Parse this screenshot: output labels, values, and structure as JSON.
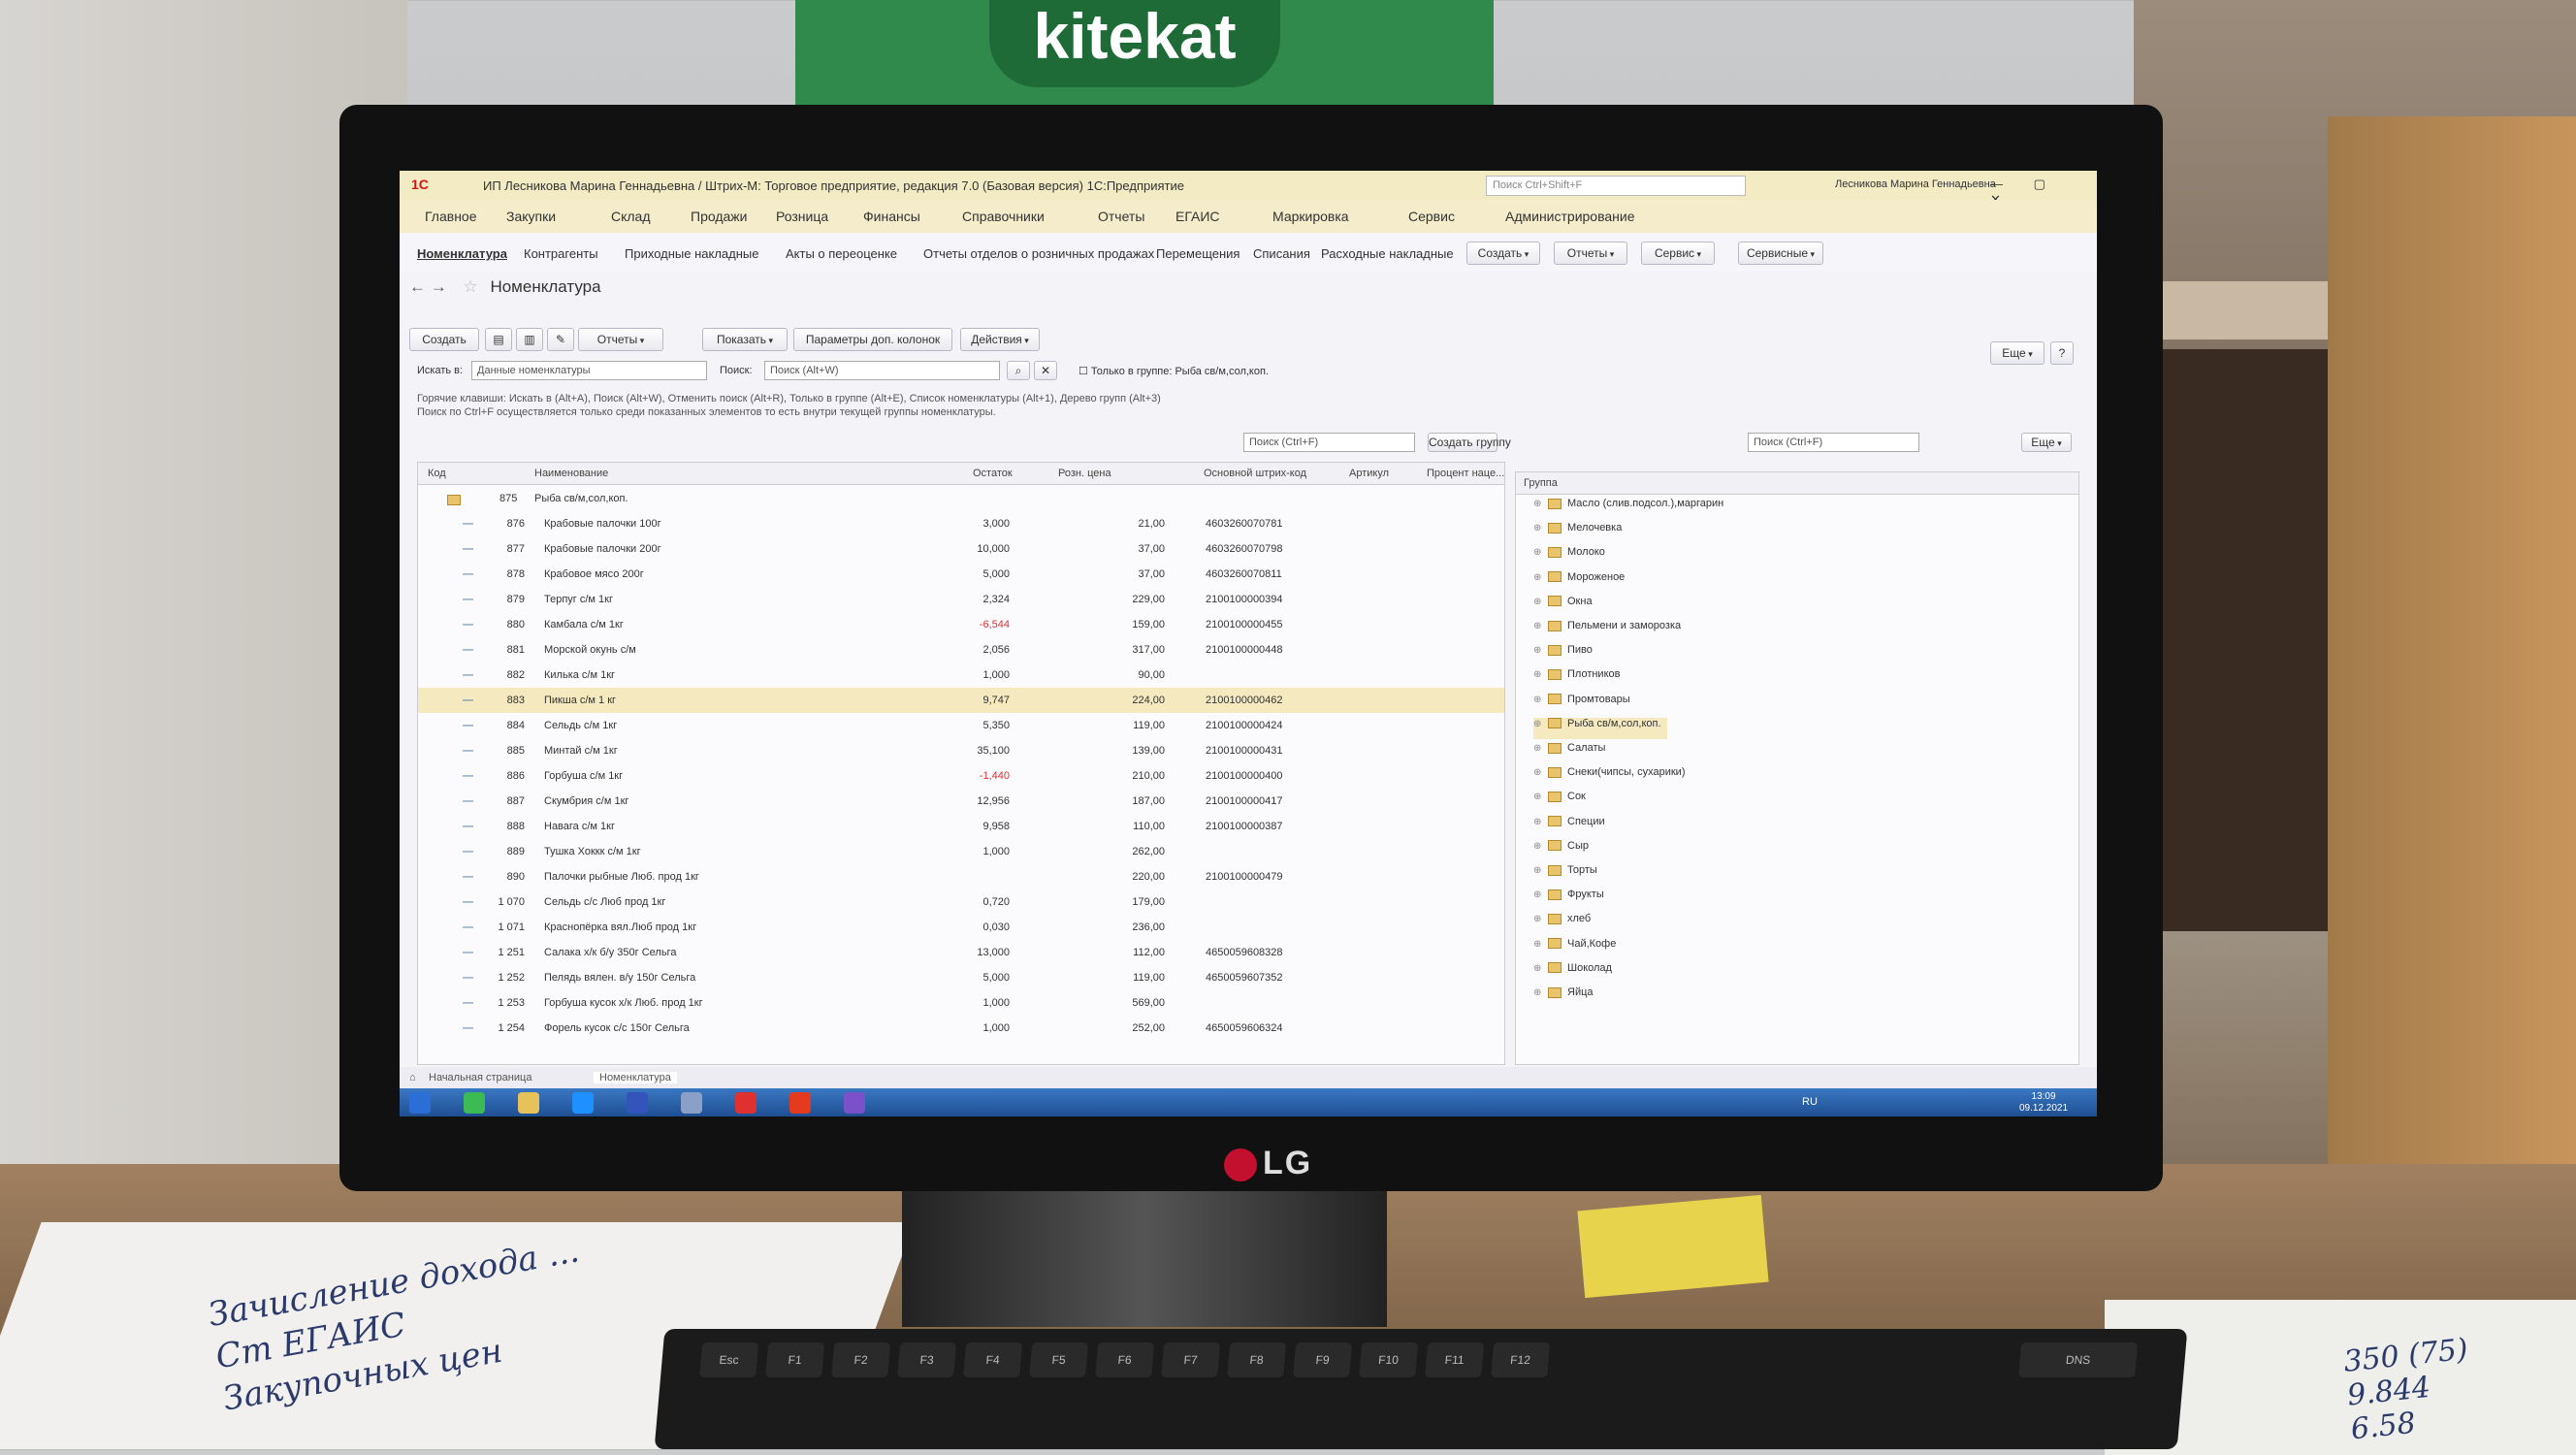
{
  "scene": {
    "brand": "kitekat",
    "monitor_brand": "LG",
    "keyboard_brand": "DNS",
    "note_left": "Зачисление дохода ...\nСт ЕГАИС\nЗакупочных цен",
    "note_right": "350 (75)\n9.844\n6.58",
    "keys": [
      "Esc",
      "F1",
      "F2",
      "F3",
      "F4",
      "F5",
      "F6",
      "F7",
      "F8",
      "F9",
      "F10",
      "F11",
      "F12"
    ]
  },
  "window": {
    "app_logo": "1С",
    "title": "ИП Лесникова Марина Геннадьевна / Штрих-М: Торговое предприятие, редакция 7.0 (Базовая версия) 1С:Предприятие",
    "search_placeholder": "Поиск Ctrl+Shift+F",
    "user": "Лесникова Марина Геннадьевна",
    "controls": "— ▢ ✕"
  },
  "menu": [
    "Главное",
    "Закупки",
    "Склад",
    "Продажи",
    "Розница",
    "Финансы",
    "Справочники",
    "Отчеты",
    "ЕГАИС",
    "Маркировка",
    "Сервис",
    "Администрирование"
  ],
  "submenu": [
    "Номенклатура",
    "Контрагенты",
    "Приходные накладные",
    "Акты о переоценке",
    "Отчеты отделов о розничных продажах",
    "Перемещения",
    "Списания",
    "Расходные накладные"
  ],
  "submenu_buttons": [
    "Создать",
    "Отчеты",
    "Сервис",
    "Сервисные"
  ],
  "form": {
    "title": "Номенклатура",
    "buttons": {
      "create": "Создать",
      "reports": "Отчеты",
      "show": "Показать",
      "params": "Параметры доп. колонок",
      "actions": "Действия",
      "more": "Еще",
      "help": "?"
    },
    "search_in_label": "Искать в:",
    "search_in_value": "Данные номенклатуры",
    "search_label": "Поиск:",
    "search_placeholder": "Поиск (Alt+W)",
    "group_only": "Только в группе: Рыба св/м,сол,коп.",
    "hint1": "Горячие клавиши: Искать в (Alt+A), Поиск (Alt+W), Отменить поиск (Alt+R), Только в группе (Alt+E), Список номенклатуры (Alt+1), Дерево групп (Alt+3)",
    "hint2": "Поиск по Ctrl+F осуществляется только среди показанных элементов то есть внутри текущей группы номенклатуры.",
    "list_search_placeholder": "Поиск (Ctrl+F)",
    "create_group": "Создать группу",
    "tree_search_placeholder": "Поиск (Ctrl+F)",
    "tree_more": "Еще"
  },
  "table": {
    "headers": [
      "Код",
      "Наименование",
      "Остаток",
      "Розн. цена",
      "Основной штрих-код",
      "Артикул",
      "Процент наце..."
    ],
    "group_row": {
      "code": "875",
      "name": "Рыба св/м,сол,коп."
    },
    "rows": [
      {
        "code": "876",
        "name": "Крабовые палочки 100г",
        "stock": "3,000",
        "price": "21,00",
        "barcode": "4603260070781"
      },
      {
        "code": "877",
        "name": "Крабовые палочки 200г",
        "stock": "10,000",
        "price": "37,00",
        "barcode": "4603260070798"
      },
      {
        "code": "878",
        "name": "Крабовое мясо 200г",
        "stock": "5,000",
        "price": "37,00",
        "barcode": "4603260070811"
      },
      {
        "code": "879",
        "name": "Терпуг с/м 1кг",
        "stock": "2,324",
        "price": "229,00",
        "barcode": "2100100000394"
      },
      {
        "code": "880",
        "name": "Камбала с/м 1кг",
        "stock": "-6,544",
        "price": "159,00",
        "barcode": "2100100000455"
      },
      {
        "code": "881",
        "name": "Морской окунь с/м",
        "stock": "2,056",
        "price": "317,00",
        "barcode": "2100100000448"
      },
      {
        "code": "882",
        "name": "Килька с/м 1кг",
        "stock": "1,000",
        "price": "90,00",
        "barcode": ""
      },
      {
        "code": "883",
        "name": "Пикша с/м 1 кг",
        "stock": "9,747",
        "price": "224,00",
        "barcode": "2100100000462"
      },
      {
        "code": "884",
        "name": "Сельдь с/м 1кг",
        "stock": "5,350",
        "price": "119,00",
        "barcode": "2100100000424"
      },
      {
        "code": "885",
        "name": "Минтай с/м 1кг",
        "stock": "35,100",
        "price": "139,00",
        "barcode": "2100100000431"
      },
      {
        "code": "886",
        "name": "Горбуша с/м 1кг",
        "stock": "-1,440",
        "price": "210,00",
        "barcode": "2100100000400"
      },
      {
        "code": "887",
        "name": "Скумбрия с/м 1кг",
        "stock": "12,956",
        "price": "187,00",
        "barcode": "2100100000417"
      },
      {
        "code": "888",
        "name": "Навага с/м 1кг",
        "stock": "9,958",
        "price": "110,00",
        "barcode": "2100100000387"
      },
      {
        "code": "889",
        "name": "Тушка Хоккк с/м 1кг",
        "stock": "1,000",
        "price": "262,00",
        "barcode": ""
      },
      {
        "code": "890",
        "name": "Палочки рыбные Люб. прод 1кг",
        "stock": "",
        "price": "220,00",
        "barcode": "2100100000479"
      },
      {
        "code": "1 070",
        "name": "Сельдь с/с Люб прод 1кг",
        "stock": "0,720",
        "price": "179,00",
        "barcode": ""
      },
      {
        "code": "1 071",
        "name": "Краснопёрка вял.Люб прод 1кг",
        "stock": "0,030",
        "price": "236,00",
        "barcode": ""
      },
      {
        "code": "1 251",
        "name": "Салака х/к б/у 350г Сельга",
        "stock": "13,000",
        "price": "112,00",
        "barcode": "4650059608328"
      },
      {
        "code": "1 252",
        "name": "Пелядь вялен. в/у 150г Сельга",
        "stock": "5,000",
        "price": "119,00",
        "barcode": "4650059607352"
      },
      {
        "code": "1 253",
        "name": "Горбуша кусок х/к Люб. прод 1кг",
        "stock": "1,000",
        "price": "569,00",
        "barcode": ""
      },
      {
        "code": "1 254",
        "name": "Форель кусок с/с 150г Сельга",
        "stock": "1,000",
        "price": "252,00",
        "barcode": "4650059606324"
      }
    ]
  },
  "tree": {
    "header": "Группа",
    "items": [
      "Масло (слив.подсол.),маргарин",
      "Мелочевка",
      "Молоко",
      "Мороженое",
      "Окна",
      "Пельмени и заморозка",
      "Пиво",
      "Плотников",
      "Промтовары",
      "Рыба св/м,сол,коп.",
      "Салаты",
      "Снеки(чипсы, сухарики)",
      "Сок",
      "Специи",
      "Сыр",
      "Торты",
      "Фрукты",
      "хлеб",
      "Чай,Кофе",
      "Шоколад",
      "Яйца"
    ],
    "selected_index": 9
  },
  "bottom_tabs": [
    "Начальная страница",
    "Номенклатура"
  ],
  "taskbar": {
    "lang": "RU",
    "time": "13:09",
    "date": "09.12.2021",
    "icon_colors": [
      "#2b6fd6",
      "#3cba54",
      "#e7c25a",
      "#1e90ff",
      "#3355bb",
      "#8aa0c8",
      "#e03030",
      "#e63a1e",
      "#7b51c9"
    ]
  }
}
